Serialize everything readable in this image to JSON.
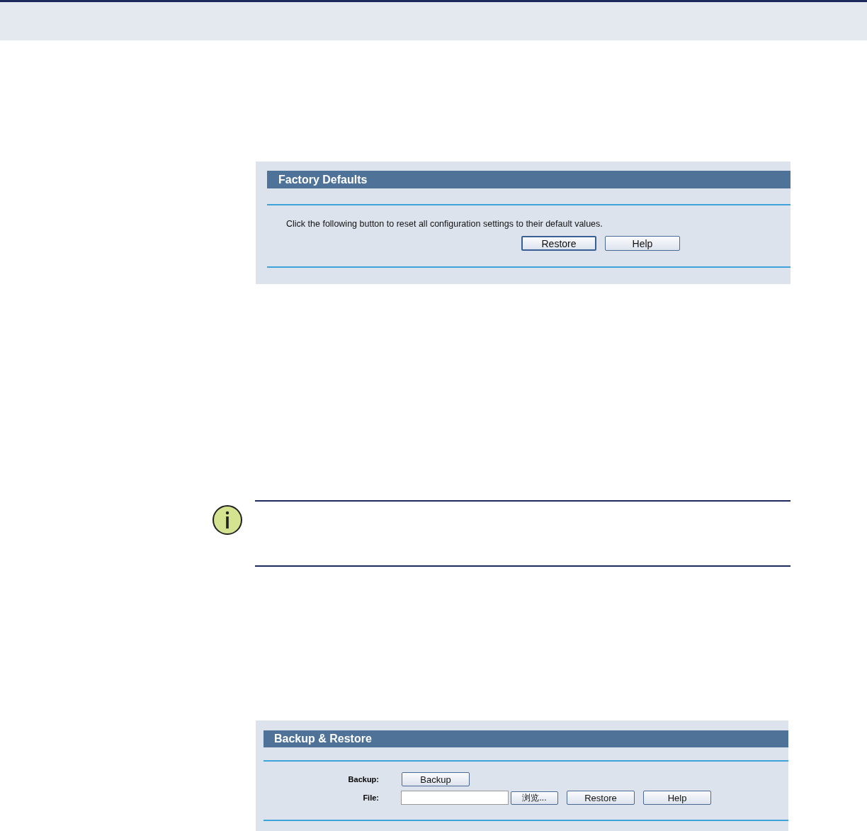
{
  "factory_defaults": {
    "title": "Factory Defaults",
    "description": "Click the following button to reset all configuration settings to their default values.",
    "buttons": [
      "Restore",
      "Help"
    ]
  },
  "backup_restore": {
    "title": "Backup & Restore",
    "backup_label": "Backup:",
    "backup_button": "Backup",
    "file_label": "File:",
    "browse_button": "浏览...",
    "buttons": [
      "Restore",
      "Help"
    ]
  }
}
